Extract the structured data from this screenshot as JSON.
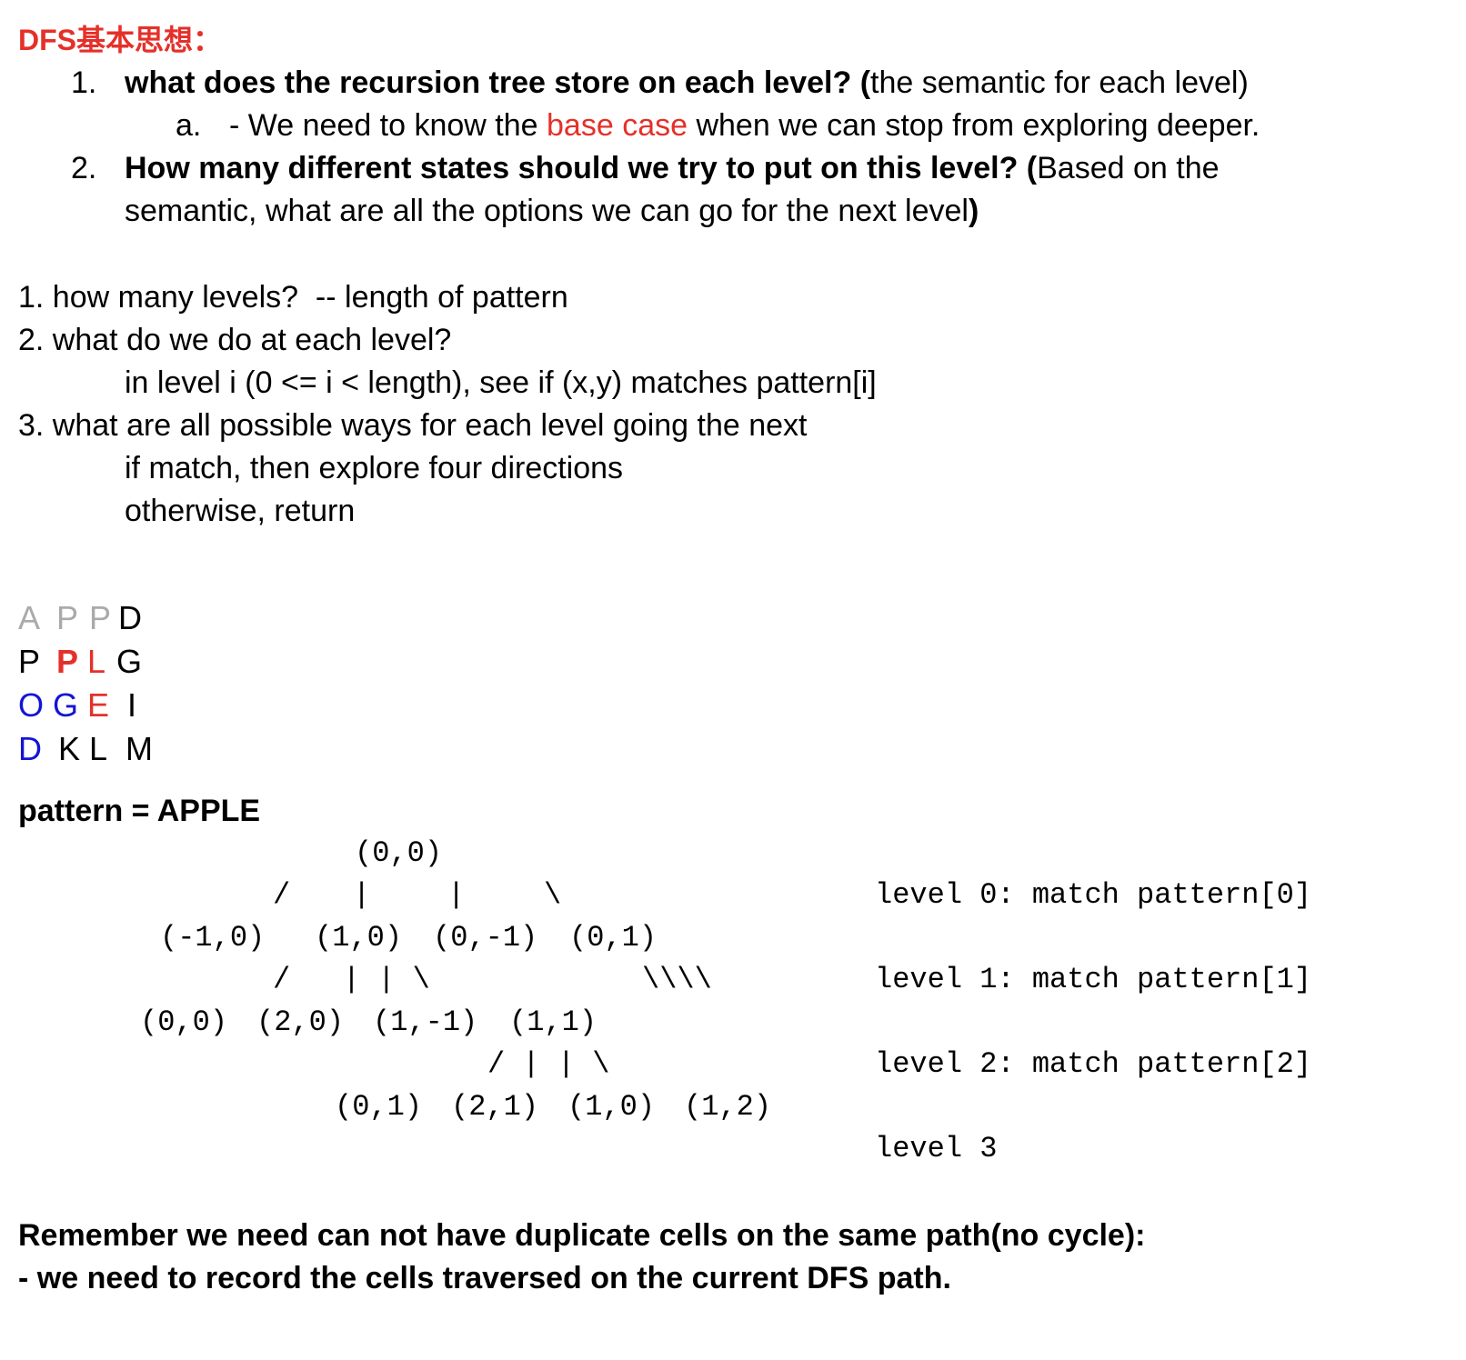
{
  "title": "DFS基本思想：",
  "principles": [
    {
      "num": "1.",
      "bold": "what does the recursion tree store on each level? (",
      "rest": "the semantic for each level)"
    },
    {
      "num": "2.",
      "bold": "How many different states should we try to put on this level? (",
      "rest": "Based on the"
    }
  ],
  "sub_a": {
    "letter": "a.",
    "pre": "- We need to know the ",
    "highlight": "base case",
    "post": " when we can stop from exploring deeper."
  },
  "principle2_cont": {
    "text": "semantic, what are all the options we can go for the next level",
    "close": ")"
  },
  "questions": {
    "q1": "1. how many levels?  -- length of pattern",
    "q2": "2. what do we do at each level?",
    "q2_detail": "in level i (0 <= i < length), see if (x,y) matches pattern[i]",
    "q3": "3. what are all possible ways for each level going the next",
    "q3_detail1": "if match, then explore four directions",
    "q3_detail2": "otherwise, return"
  },
  "grid": [
    [
      {
        "ch": "A",
        "color": "gray"
      },
      {
        "ch": "P",
        "color": "gray"
      },
      {
        "ch": "P",
        "color": "gray"
      },
      {
        "ch": "D",
        "color": "black"
      }
    ],
    [
      {
        "ch": "P",
        "color": "black"
      },
      {
        "ch": "P",
        "color": "red",
        "bold": true
      },
      {
        "ch": "L",
        "color": "red"
      },
      {
        "ch": "G",
        "color": "black"
      }
    ],
    [
      {
        "ch": "O",
        "color": "blue"
      },
      {
        "ch": "G",
        "color": "blue"
      },
      {
        "ch": "E",
        "color": "red"
      },
      {
        "ch": "I",
        "color": "black"
      }
    ],
    [
      {
        "ch": "D",
        "color": "blue"
      },
      {
        "ch": "K",
        "color": "black"
      },
      {
        "ch": "L",
        "color": "black"
      },
      {
        "ch": "M",
        "color": "black"
      }
    ]
  ],
  "colors": {
    "red": "#e5302a",
    "gray": "#aaaaaa",
    "blue": "#1414d6",
    "black": "#000000"
  },
  "pattern": "pattern = APPLE",
  "tree": {
    "root": "(0,0)",
    "edges1": [
      "/",
      "|",
      "|",
      "\\"
    ],
    "level1_nodes": [
      "(-1,0)",
      "(1,0)",
      "(0,-1)",
      "(0,1)"
    ],
    "edges2_left": "/   | | \\",
    "edges2_right": "\\\\\\\\",
    "level2_nodes": [
      "(0,0)",
      "(2,0)",
      "(1,-1)",
      "(1,1)"
    ],
    "edges3": "/ | | \\",
    "level3_nodes": [
      "(0,1)",
      "(2,1)",
      "(1,0)",
      "(1,2)"
    ]
  },
  "levels": [
    "level 0: match pattern[0]",
    "level 1: match pattern[1]",
    "level 2: match pattern[2]",
    "level 3"
  ],
  "remember": {
    "line1": "Remember we need can not have duplicate cells on the same path(no cycle):",
    "line2": "- we need to record the cells traversed on the current DFS path."
  }
}
